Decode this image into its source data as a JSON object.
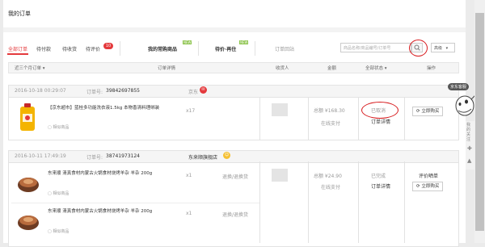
{
  "page": {
    "title": "我的订单"
  },
  "tabs": [
    {
      "label": "全部订单",
      "active": true
    },
    {
      "label": "待付款"
    },
    {
      "label": "待收货"
    },
    {
      "label": "待评价",
      "badge": "10"
    }
  ],
  "special_tabs": [
    {
      "label": "我的常购商品",
      "tag": "NEW"
    },
    {
      "label": "待价·再住",
      "tag": "NEW"
    },
    {
      "label": "订单回站"
    }
  ],
  "search": {
    "placeholder": "商品名称/商品编号/订单号",
    "advanced_label": "高级"
  },
  "table_header": {
    "range": "近三个月订单",
    "details": "订单详情",
    "recipient": "收货人",
    "amount": "金额",
    "status": "全部状态",
    "actions": "操作"
  },
  "orders": [
    {
      "date": "2016-10-18 00:29:07",
      "order_label": "订单号:",
      "order_no": "39842697855",
      "shop": "京东",
      "product_name": "【京东超市】蓝桂多功能洗衣液1.5kg 本物香清料理绑装",
      "gift_label": "相似商品",
      "qty": "x17",
      "total": "总额 ¥168.30",
      "pay_method": "在线支付",
      "status": "已取消",
      "status_link": "订单详情",
      "action": "立即购买"
    },
    {
      "date": "2016-10-11 17:49:19",
      "order_label": "订单号:",
      "order_no": "38741973124",
      "shop": "东来顺旗舰店",
      "items": [
        {
          "product_name": "东来顺 清真食材内蒙古火锅食材烧烤羊杂 羊杂 200g",
          "similar_label": "相似商品",
          "qty": "x1",
          "after_sale": "退换/退换货"
        },
        {
          "product_name": "东来顺 清真食材内蒙古火锅食材烧烤羊杂 羊杂 200g",
          "similar_label": "相似商品",
          "qty": "x1",
          "after_sale": "退换/退换货"
        }
      ],
      "total": "总额 ¥24.90",
      "pay_method": "在线支付",
      "status": "已完成",
      "status_link": "订单详情",
      "review": "评价晒单",
      "action": "立即购买"
    }
  ],
  "float_widget": {
    "label": "京东客服"
  },
  "side_tools": {
    "label": "我的关注"
  },
  "colors": {
    "accent": "#e4393c",
    "annotation": "#d7191c"
  }
}
